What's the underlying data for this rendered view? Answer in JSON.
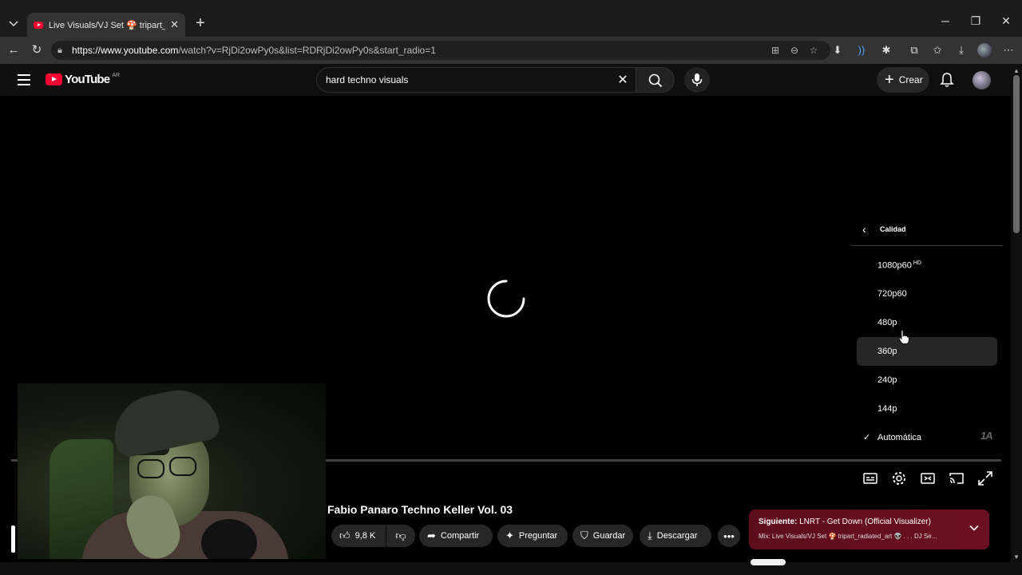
{
  "browser": {
    "tab_title": "Live Visuals/VJ Set 🍄 tripart_radiat",
    "url_host": "https://www.youtube.com",
    "url_path": "/watch?v=RjDi2owPy0s&list=RDRjDi2owPy0s&start_radio=1"
  },
  "youtube": {
    "logo_text": "YouTube",
    "country_code": "AR",
    "search_value": "hard techno visuals",
    "create_label": "Crear"
  },
  "quality_menu": {
    "title": "Calidad",
    "options": [
      {
        "label": "1080p60",
        "badge": "HD"
      },
      {
        "label": "720p60",
        "badge": ""
      },
      {
        "label": "480p",
        "badge": ""
      },
      {
        "label": "360p",
        "badge": ""
      },
      {
        "label": "240p",
        "badge": ""
      },
      {
        "label": "144p",
        "badge": ""
      },
      {
        "label": "Automática",
        "badge": ""
      }
    ],
    "selected": "Automática",
    "hovered": "360p"
  },
  "video": {
    "title": "Fabio Panaro Techno Keller Vol. 03",
    "likes": "9,8 K",
    "share_label": "Compartir",
    "ask_label": "Preguntar",
    "save_label": "Guardar",
    "download_label": "Descargar"
  },
  "next_up": {
    "prefix": "Siguiente:",
    "title": "LNRT - Get Down (Official Visualizer)",
    "mix": "Mix: Live Visuals/VJ Set 🍄 tripart_radiated_art 👽 . . . DJ Se..."
  },
  "colors": {
    "youtube_red": "#ff0033",
    "next_card": "#6b1022"
  }
}
